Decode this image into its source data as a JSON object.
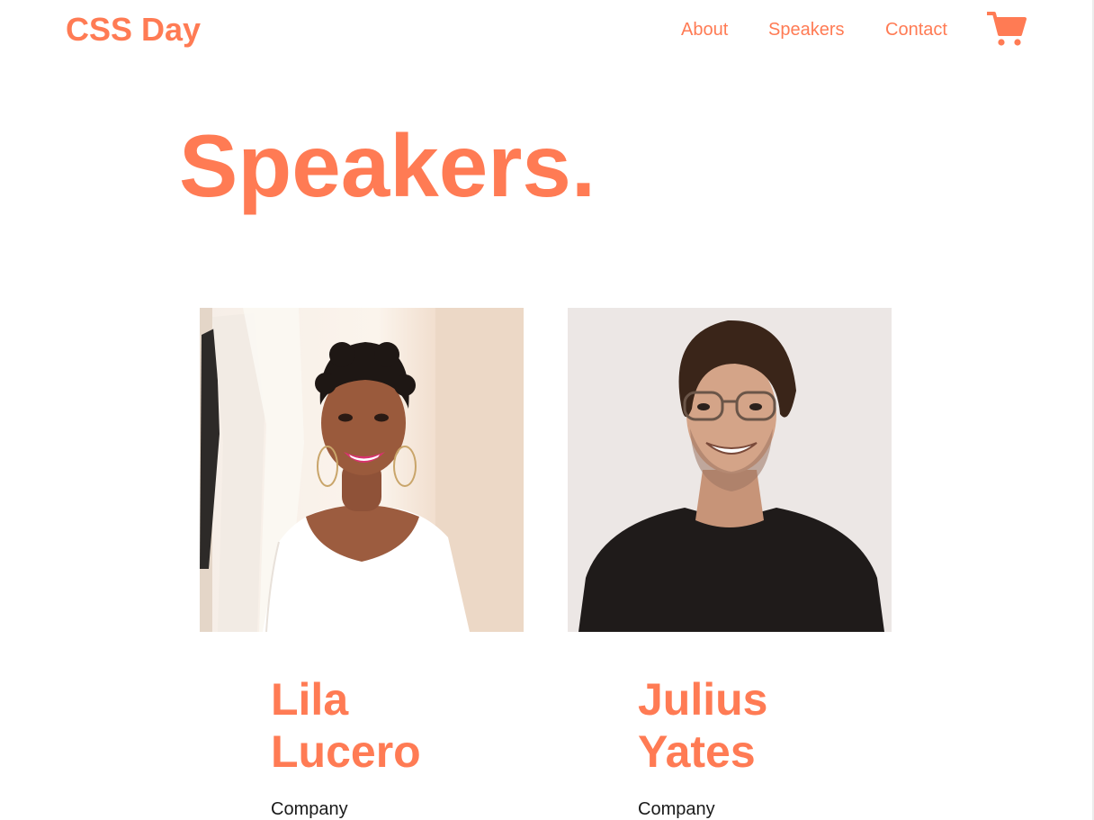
{
  "header": {
    "brand": "CSS Day",
    "nav": {
      "about": "About",
      "speakers": "Speakers",
      "contact": "Contact"
    },
    "cart_icon": "shopping-cart-icon"
  },
  "main": {
    "title": "Speakers."
  },
  "speakers": [
    {
      "first_name": "Lila",
      "last_name": "Lucero",
      "company": "Company",
      "photo_icon": "speaker-photo"
    },
    {
      "first_name": "Julius",
      "last_name": "Yates",
      "company": "Company",
      "photo_icon": "speaker-photo"
    }
  ],
  "colors": {
    "accent": "#ff7b54",
    "text": "#1a1a1a",
    "background": "#ffffff"
  }
}
